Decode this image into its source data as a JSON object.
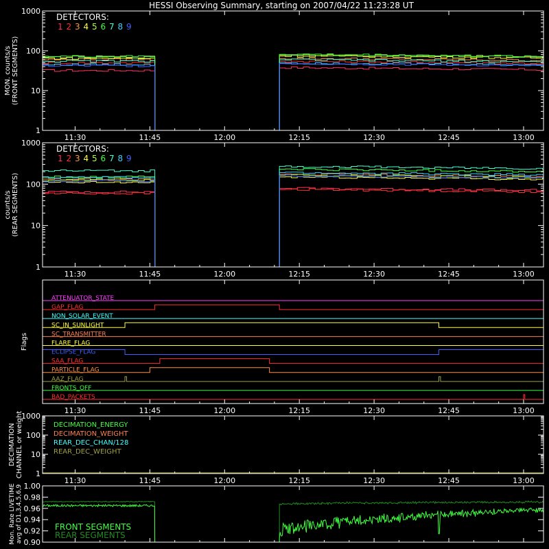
{
  "title": "HESSI Observing Summary, starting on 2007/04/22 11:23:28 UT",
  "time_ticks": [
    "11:30",
    "11:45",
    "12:00",
    "12:15",
    "12:30",
    "12:45",
    "13:00"
  ],
  "colors": {
    "det": [
      "#ff3060",
      "#ff3030",
      "#ff9050",
      "#ffff40",
      "#b0ff40",
      "#40ff40",
      "#40ffd0",
      "#40d0ff",
      "#4060ff"
    ],
    "frame": "#ffffff"
  },
  "chart_data": [
    {
      "type": "line",
      "panel": "front",
      "ylabel": [
        "MON. counts/s",
        "(FRONT SEGMENTS)"
      ],
      "yscale": "log",
      "ylim": [
        1,
        1000
      ],
      "yticks": [
        "1",
        "10",
        "100",
        "1000"
      ],
      "xlim": [
        "11:23:28",
        "13:04"
      ],
      "legend_title": "DETECTORS:",
      "legend_labels": [
        "1",
        "2",
        "3",
        "4",
        "5",
        "6",
        "7",
        "8",
        "9"
      ],
      "gap": [
        "11:46",
        "12:11"
      ],
      "series": [
        {
          "name": "1",
          "before": 32,
          "after": 38
        },
        {
          "name": "2",
          "before": 50,
          "after": 55
        },
        {
          "name": "3",
          "before": 60,
          "after": 65
        },
        {
          "name": "4",
          "before": 65,
          "after": 75
        },
        {
          "name": "5",
          "before": 70,
          "after": 80
        },
        {
          "name": "6",
          "before": 72,
          "after": 82
        },
        {
          "name": "7",
          "before": 55,
          "after": 60
        },
        {
          "name": "8",
          "before": 45,
          "after": 50
        },
        {
          "name": "9",
          "before": 42,
          "after": 48
        }
      ]
    },
    {
      "type": "line",
      "panel": "rear",
      "ylabel": [
        "counts/s",
        "(REAR SEGMENTS)"
      ],
      "yscale": "log",
      "ylim": [
        1,
        1000
      ],
      "yticks": [
        "1",
        "10",
        "100",
        "1000"
      ],
      "xlim": [
        "11:23:28",
        "13:04"
      ],
      "legend_title": "DETECTORS:",
      "legend_labels": [
        "1",
        "2",
        "3",
        "4",
        "5",
        "6",
        "7",
        "8",
        "9"
      ],
      "gap": [
        "11:46",
        "12:11"
      ],
      "series": [
        {
          "name": "1",
          "before": 65,
          "after": 80
        },
        {
          "name": "2",
          "before": 60,
          "after": 75
        },
        {
          "name": "3",
          "before": 130,
          "after": 175
        },
        {
          "name": "4",
          "before": 110,
          "after": 150
        },
        {
          "name": "5",
          "before": 125,
          "after": 165
        },
        {
          "name": "6",
          "before": 150,
          "after": 230
        },
        {
          "name": "7",
          "before": 210,
          "after": 270
        },
        {
          "name": "8",
          "before": 145,
          "after": 190
        },
        {
          "name": "9",
          "before": 120,
          "after": 160
        }
      ]
    },
    {
      "type": "flags",
      "panel": "flags",
      "ylabel": "Flags",
      "flags": [
        {
          "name": "ATTENUATOR_STATE",
          "color": "#ff40ff",
          "high": []
        },
        {
          "name": "GAP_FLAG",
          "color": "#ff3030",
          "high": [
            [
              "11:46",
              "12:11"
            ]
          ]
        },
        {
          "name": "NON_SOLAR_EVENT",
          "color": "#40ffff",
          "high": []
        },
        {
          "name": "SC_IN_SUNLIGHT",
          "color": "#ffff40",
          "high": [
            [
              "11:40",
              "12:43"
            ]
          ]
        },
        {
          "name": "SC_TRANSMITTER",
          "color": "#ff8050",
          "high": []
        },
        {
          "name": "FLARE_FLAG",
          "color": "#ffff40",
          "high": []
        },
        {
          "name": "ECLIPSE_FLAG",
          "color": "#4060ff",
          "high": [
            [
              "11:23:28",
              "11:40"
            ],
            [
              "12:43",
              "13:04"
            ]
          ]
        },
        {
          "name": "SAA_FLAG",
          "color": "#ff3030",
          "high": [
            [
              "11:47",
              "12:09"
            ]
          ]
        },
        {
          "name": "PARTICLE_FLAG",
          "color": "#ff9040",
          "high": [
            [
              "11:45",
              "12:09"
            ]
          ]
        },
        {
          "name": "AAZ_FLAG",
          "color": "#a0a040",
          "high": [
            [
              "11:40",
              "11:40:20"
            ],
            [
              "12:43",
              "12:43:20"
            ]
          ]
        },
        {
          "name": "FRONTS_OFF",
          "color": "#40ff40",
          "high": []
        },
        {
          "name": "BAD_PACKETS",
          "color": "#ff3030",
          "high": [
            [
              "13:00",
              "13:00:15"
            ]
          ]
        }
      ]
    },
    {
      "type": "line",
      "panel": "decimation",
      "ylabel": [
        "DECIMATION",
        "CHANNEL or weight"
      ],
      "yscale": "log",
      "ylim": [
        1,
        1000
      ],
      "yticks": [
        "1",
        "10",
        "100",
        "1000"
      ],
      "legend_labels": [
        "DECIMATION_ENERGY",
        "DECIMATION_WEIGHT",
        "REAR_DEC_CHAN/128",
        "REAR_DEC_WEIGHT"
      ],
      "legend_colors": [
        "#40ff40",
        "#ff8050",
        "#40ffff",
        "#a0a040"
      ],
      "series": [
        {
          "name": "REAR_DEC_WEIGHT",
          "constant": 1
        }
      ]
    },
    {
      "type": "line",
      "panel": "livetime",
      "ylabel": [
        "Mon. Rate LIVETIME",
        "avg of D1,3,4,5,6,9"
      ],
      "ylim": [
        0.9,
        1.0
      ],
      "yticks": [
        "0.90",
        "0.92",
        "0.94",
        "0.96",
        "0.98",
        "1.00"
      ],
      "legend_labels": [
        "FRONT SEGMENTS",
        "REAR SEGMENTS"
      ],
      "legend_colors": [
        "#40ff40",
        "#208a20"
      ],
      "gap": [
        "11:46",
        "12:11"
      ],
      "series": [
        {
          "name": "FRONT SEGMENTS",
          "before": 0.965,
          "after_start": 0.93,
          "after_end": 0.96
        },
        {
          "name": "REAR SEGMENTS",
          "before": 0.972,
          "after_start": 0.968,
          "after_end": 0.972
        }
      ]
    }
  ]
}
